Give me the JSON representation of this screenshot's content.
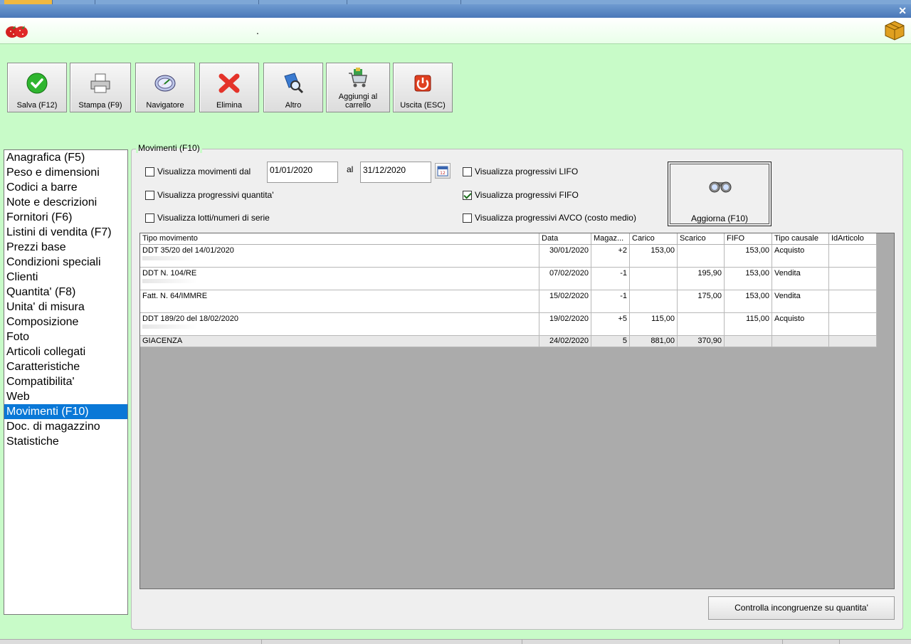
{
  "toolbar": {
    "save": "Salva (F12)",
    "print": "Stampa (F9)",
    "navigator": "Navigatore",
    "delete": "Elimina",
    "other": "Altro",
    "add_to_cart_line1": "Aggiungi al",
    "add_to_cart_line2": "carrello",
    "exit": "Uscita (ESC)"
  },
  "header": {
    "dot": "."
  },
  "sidebar": {
    "items": [
      "Anagrafica (F5)",
      "Peso e dimensioni",
      "Codici a barre",
      "Note e descrizioni",
      "Fornitori (F6)",
      "Listini di vendita (F7)",
      "Prezzi base",
      "Condizioni speciali",
      "Clienti",
      "Quantita' (F8)",
      "Unita' di misura",
      "Composizione",
      "Foto",
      "Articoli collegati",
      "Caratteristiche",
      "Compatibilita'",
      "Web",
      "Movimenti (F10)",
      "Doc. di magazzino",
      "Statistiche"
    ],
    "selected_index": 17
  },
  "panel": {
    "title": "Movimenti (F10)",
    "show_movements_from": "Visualizza movimenti dal",
    "date_from": "01/01/2020",
    "to_label": "al",
    "date_to": "31/12/2020",
    "show_qty_progressive": "Visualizza progressivi quantita'",
    "show_lots": "Visualizza lotti/numeri di serie",
    "show_lifo": "Visualizza progressivi LIFO",
    "show_fifo": "Visualizza progressivi FIFO",
    "show_avco": "Visualizza progressivi AVCO (costo medio)",
    "checks": {
      "movements": false,
      "qty": false,
      "lots": false,
      "lifo": false,
      "fifo": true,
      "avco": false
    },
    "refresh_button": "Aggiorna (F10)",
    "check_button": "Controlla incongruenze su quantita'"
  },
  "grid": {
    "columns": [
      "Tipo movimento",
      "Data",
      "Magaz...",
      "Carico",
      "Scarico",
      "FIFO",
      "Tipo causale",
      "IdArticolo"
    ],
    "rows": [
      {
        "tipo": "DDT 35/20 del 14/01/2020",
        "data": "30/01/2020",
        "magaz": "+2",
        "carico": "153,00",
        "scarico": "",
        "fifo": "153,00",
        "causale": "Acquisto",
        "id": ""
      },
      {
        "tipo": "DDT N. 104/RE",
        "data": "07/02/2020",
        "magaz": "-1",
        "carico": "",
        "scarico": "195,90",
        "fifo": "153,00",
        "causale": "Vendita",
        "id": ""
      },
      {
        "tipo": "Fatt. N. 64/IMMRE",
        "data": "15/02/2020",
        "magaz": "-1",
        "carico": "",
        "scarico": "175,00",
        "fifo": "153,00",
        "causale": "Vendita",
        "id": ""
      },
      {
        "tipo": "DDT 189/20 del 18/02/2020",
        "data": "19/02/2020",
        "magaz": "+5",
        "carico": "115,00",
        "scarico": "",
        "fifo": "115,00",
        "causale": "Acquisto",
        "id": ""
      }
    ],
    "total": {
      "tipo": "GIACENZA",
      "data": "24/02/2020",
      "magaz": "5",
      "carico": "881,00",
      "scarico": "370,90",
      "fifo": "",
      "causale": "",
      "id": ""
    }
  },
  "colors": {
    "background": "#c8fbc8",
    "selection": "#0a78d7"
  }
}
